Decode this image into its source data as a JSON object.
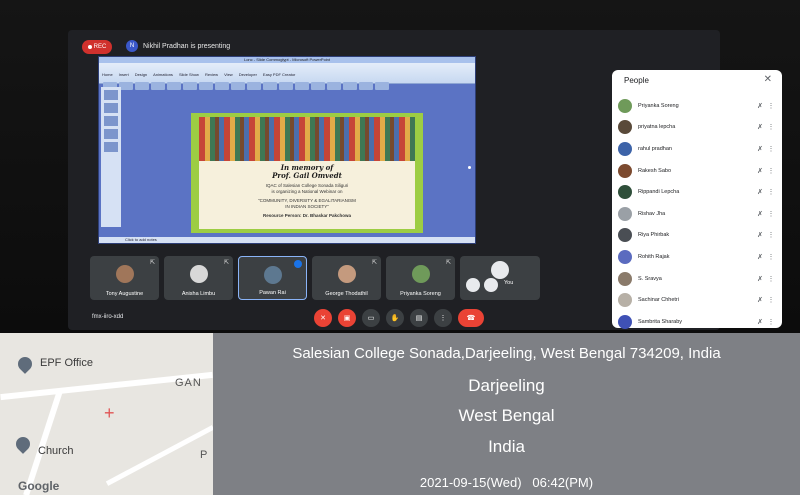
{
  "meeting": {
    "rec_label": "REC",
    "presenter_initial": "N",
    "presenter_text": "Nikhil Pradhan is presenting",
    "meeting_code": "fmx-iiro-xdd",
    "accent_color": "#1a73e8",
    "end_call_color": "#ea4335"
  },
  "ppt": {
    "window_title": "Lonc - Slide Commoglypt - Microsoft PowerPoint",
    "ribbon_tabs": [
      "Home",
      "Insert",
      "Design",
      "Animations",
      "Slide Show",
      "Review",
      "View",
      "Developer",
      "Easy PDF Creator"
    ],
    "notes_placeholder": "Click to add notes",
    "slide": {
      "memory_line1": "In memory of",
      "memory_line2": "Prof. Gail Omvedt",
      "line1": "IQAC of Salesian College Sonada Siliguri",
      "line2": "is organizing a National Webinar on",
      "line3": "\"COMMUNITY, DIVERSITY & EGALITARIANISM",
      "line4": "IN INDIAN SOCIETY\"",
      "line5": "Resource Person: Dr. Bhaskar Pakchowa"
    }
  },
  "tiles": [
    {
      "name": "Tony Augustine"
    },
    {
      "name": "Anisha Limbu"
    },
    {
      "name": "Pawan Rai"
    },
    {
      "name": "George Thodathil"
    },
    {
      "name": "Priyanka Soreng"
    }
  ],
  "you_tile": {
    "label": "You"
  },
  "people_panel": {
    "title": "People",
    "participants": [
      {
        "name": "Priyanka Soreng"
      },
      {
        "name": "priyatna lepcha"
      },
      {
        "name": "rahul pradhan"
      },
      {
        "name": "Rakesh Sabo"
      },
      {
        "name": "Rippandi Lepcha"
      },
      {
        "name": "Rishav Jha"
      },
      {
        "name": "Riya Phirbak"
      },
      {
        "name": "Rohith Rajak"
      },
      {
        "name": "S. Sravya"
      },
      {
        "name": "Sachinar Chhetri"
      },
      {
        "name": "Sambrita Sharaby"
      }
    ]
  },
  "map": {
    "epf_label": "EPF Office",
    "church_label": "Church",
    "gan_label": "GAN",
    "p_label": "P",
    "logo": "Google"
  },
  "location": {
    "address": "Salesian College Sonada,Darjeeling, West Bengal 734209, India",
    "city": "Darjeeling",
    "state": "West Bengal",
    "country": "India",
    "timestamp": "2021-09-15(Wed)   06:42(PM)"
  }
}
